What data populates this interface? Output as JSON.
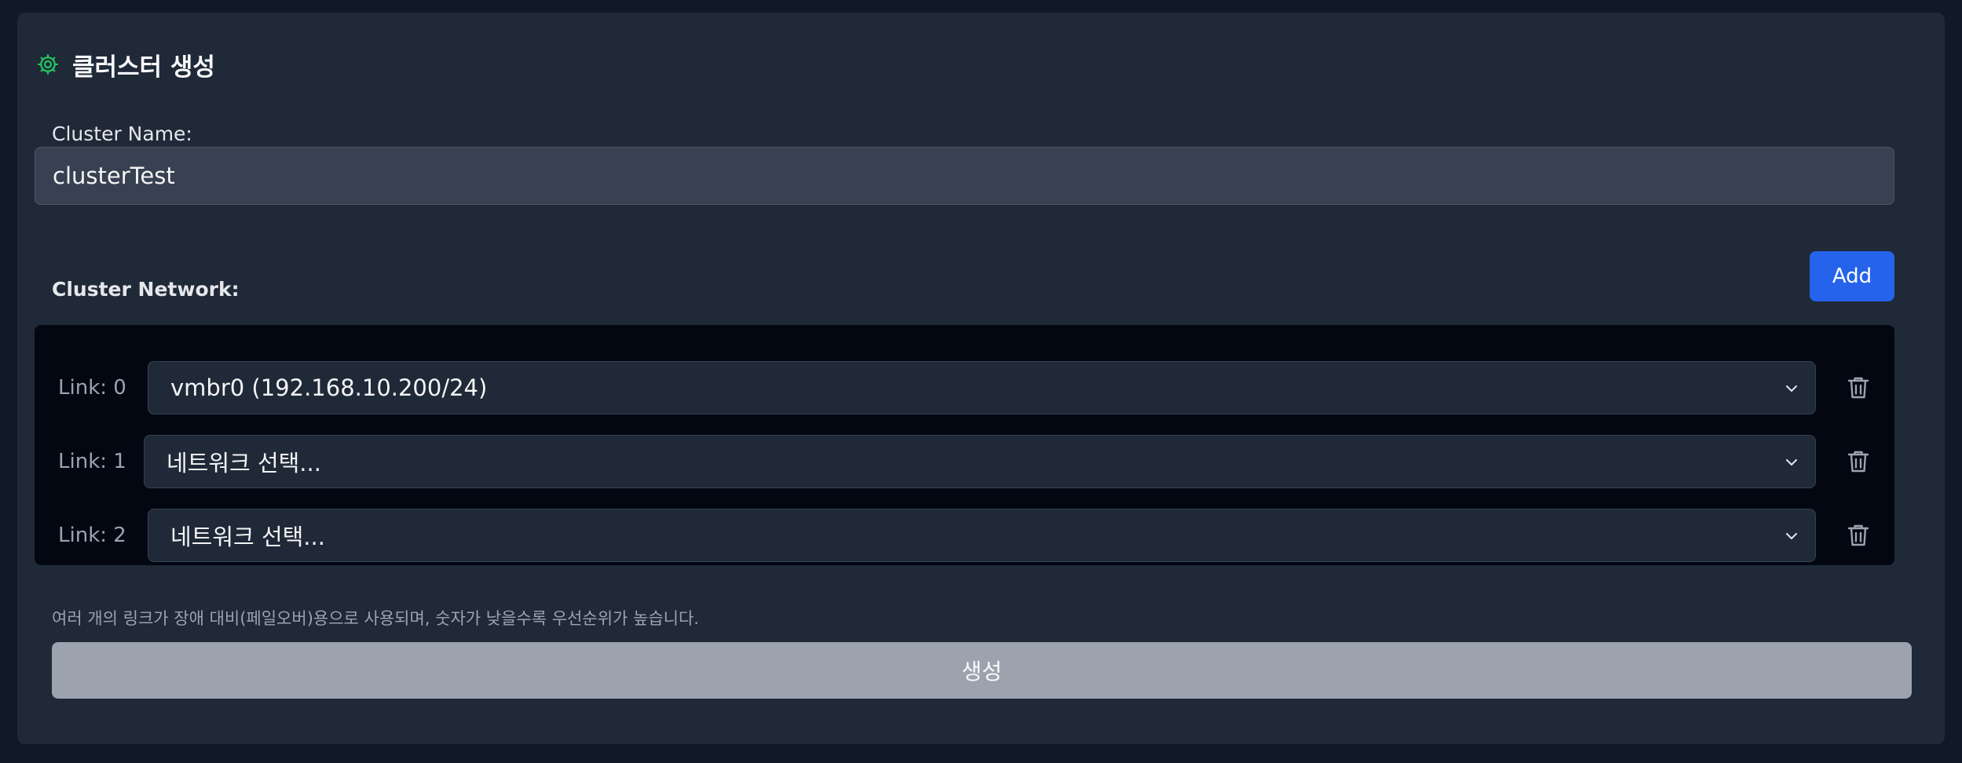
{
  "panel": {
    "title": "클러스터 생성",
    "title_icon": "gear-icon",
    "accent_color": "#22c55e"
  },
  "cluster_name": {
    "label": "Cluster Name:",
    "value": "clusterTest"
  },
  "cluster_network": {
    "label": "Cluster Network:",
    "add_label": "Add",
    "links": [
      {
        "label": "Link: 0",
        "selected": "vmbr0 (192.168.10.200/24)"
      },
      {
        "label": "Link: 1",
        "selected": "네트워크 선택..."
      },
      {
        "label": "Link: 2",
        "selected": "네트워크 선택..."
      }
    ],
    "hint": "여러 개의 링크가 장애 대비(페일오버)용으로 사용되며, 숫자가 낮을수록 우선순위가 높습니다."
  },
  "actions": {
    "create_label": "생성"
  }
}
